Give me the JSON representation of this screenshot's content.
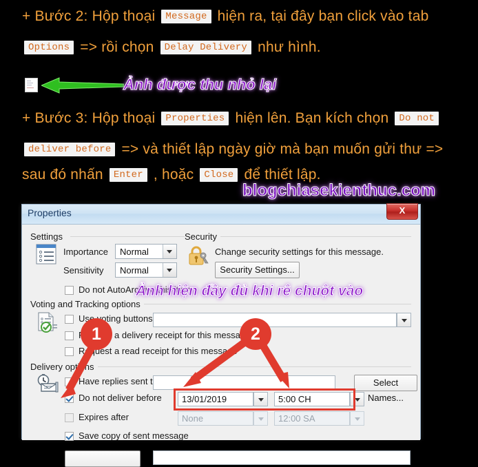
{
  "tutorial": {
    "line1_a": "+ Bước 2: Hộp thoại",
    "line1_code": "Message",
    "line1_b": "hiện ra, tại đây bạn click vào tab",
    "line2_code1": "Options",
    "line2_a": "=> rồi chọn",
    "line2_code2": "Delay Delivery",
    "line2_b": "như hình.",
    "line3_a": "+ Bước 3: Hộp thoại",
    "line3_code": "Properties",
    "line3_b": "hiện lên. Bạn kích chọn",
    "line3_code2": "Do not",
    "line4_code": "deliver before",
    "line4_a": "=> và thiết lập ngày giờ mà bạn muốn gửi thư =>",
    "line5_a": "sau đó nhấn",
    "line5_code1": "Enter",
    "line5_b": ", hoặc",
    "line5_code2": "Close",
    "line5_c": "để thiết lập.",
    "annotation_thumbnail": "Ảnh được thu nhỏ lại",
    "annotation_hover": "Ảnh hiện đầy đủ khi rê chuột vào",
    "watermark": "blogchiasekienthuc.com"
  },
  "dialog": {
    "title": "Properties",
    "close_label": "X",
    "settings": {
      "group_label": "Settings",
      "importance_label": "Importance",
      "importance_value": "Normal",
      "sensitivity_label": "Sensitivity",
      "sensitivity_value": "Normal",
      "autoarchive_label": "Do not AutoArchive this item",
      "autoarchive_checked": false
    },
    "security": {
      "group_label": "Security",
      "description": "Change security settings for this message.",
      "button_label": "Security Settings..."
    },
    "voting": {
      "group_label": "Voting and Tracking options",
      "use_voting_label": "Use voting buttons",
      "use_voting_checked": false,
      "voting_value": "",
      "delivery_receipt_label": "Request a delivery receipt for this message",
      "delivery_receipt_checked": false,
      "read_receipt_label": "Request a read receipt for this message",
      "read_receipt_checked": false
    },
    "delivery": {
      "group_label": "Delivery options",
      "have_replies_label": "Have replies sent to",
      "have_replies_checked": false,
      "have_replies_value": "",
      "select_names_label": "Select Names...",
      "do_not_deliver_label": "Do not deliver before",
      "do_not_deliver_checked": true,
      "deliver_date": "13/01/2019",
      "deliver_time": "5:00 CH",
      "expires_label": "Expires after",
      "expires_checked": false,
      "expires_date": "None",
      "expires_time": "12:00 SA",
      "save_copy_label": "Save copy of sent message",
      "save_copy_checked": true
    }
  },
  "markers": {
    "one": "1",
    "two": "2"
  },
  "colors": {
    "text_orange": "#f0a03c",
    "code_text": "#d2691e",
    "annotation_purple": "#8a12c8",
    "marker_red": "#e03b2e",
    "highlight_red": "#e03b2e",
    "arrow_green": "#2fbf20",
    "title_blue": "#1c3d66"
  }
}
